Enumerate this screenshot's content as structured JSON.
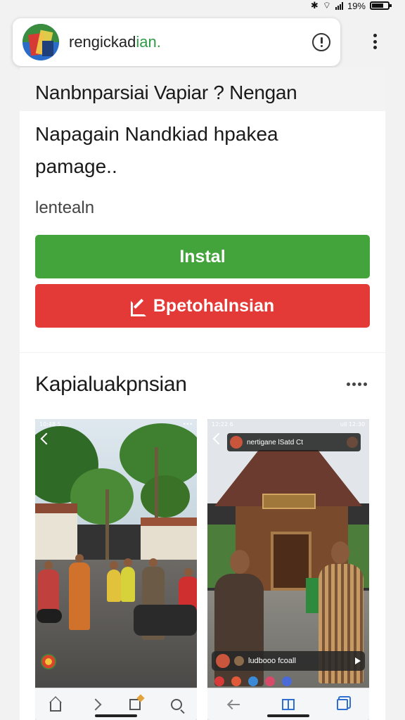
{
  "status_bar": {
    "battery_text": "19%"
  },
  "address_bar": {
    "site_name": "rengickad",
    "site_name_accent": "ian.",
    "logo_icon": "site-logo",
    "info_icon": "info-icon",
    "menu_icon": "kebab-menu-icon"
  },
  "app_card": {
    "title": "Nanbnparsiai Vapiar ? Nengan",
    "description": "Napagain Nandkiad hpakea pamage..",
    "meta": "lentealn",
    "install_label": "Instal",
    "report_label": "Bpetohalnsian",
    "colors": {
      "install": "#43a43c",
      "report": "#e43a37"
    }
  },
  "screenshots": {
    "title": "Kapialuakpnsian",
    "items": [
      {
        "status_left": "10:48 5",
        "status_right": "•••"
      },
      {
        "status_left": "12:22 6",
        "status_right": "ull 12:30",
        "bar_title": "nertigane lSatd Ct",
        "pill_text": "ludbooo fcoall"
      }
    ]
  }
}
